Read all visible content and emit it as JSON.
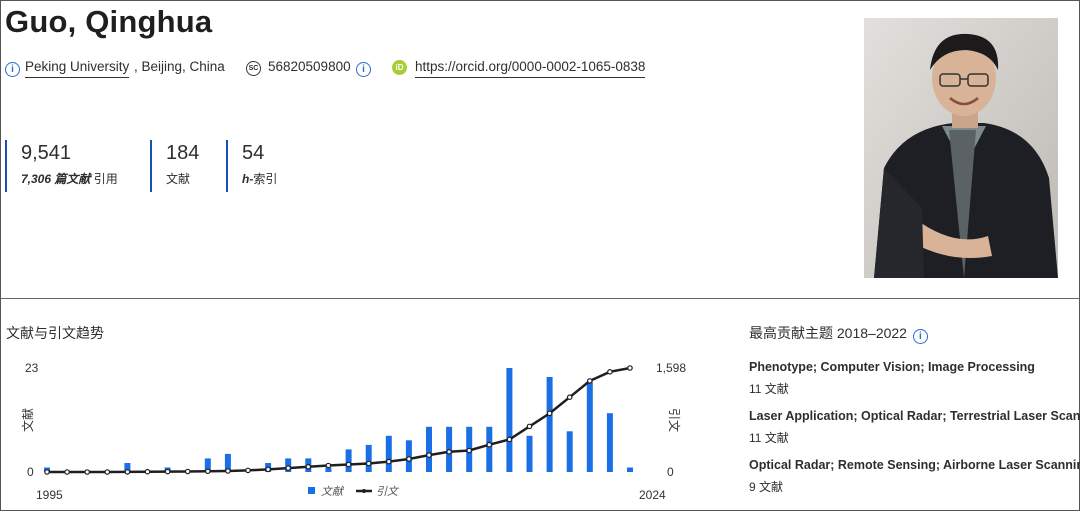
{
  "profile": {
    "name": "Guo, Qinghua",
    "affiliation_link": "Peking University",
    "affiliation_rest": ", Beijing, China",
    "scopus_id": "56820509800",
    "orcid_url": "https://orcid.org/0000-0002-1065-0838",
    "orcid_badge": "iD",
    "scopus_badge": "SC"
  },
  "metrics": [
    {
      "value": "9,541",
      "label_em": "7,306 篇文献",
      "label": "引用"
    },
    {
      "value": "184",
      "label_em": "",
      "label": "文献"
    },
    {
      "value": "54",
      "label_em": "h-",
      "label": "索引"
    }
  ],
  "trends": {
    "title": "文献与引文趋势",
    "left_axis_max": "23",
    "left_axis_min": "0",
    "right_axis_max": "1,598",
    "right_axis_min": "0",
    "left_axis_label": "文献",
    "right_axis_label": "引文",
    "x_start": "1995",
    "x_end": "2024",
    "legend_docs": "文献",
    "legend_cites": "引文"
  },
  "chart_data": {
    "type": "bar",
    "x": [
      1995,
      1996,
      1997,
      1998,
      1999,
      2000,
      2001,
      2002,
      2003,
      2004,
      2005,
      2006,
      2007,
      2008,
      2009,
      2010,
      2011,
      2012,
      2013,
      2014,
      2015,
      2016,
      2017,
      2018,
      2019,
      2020,
      2021,
      2022,
      2023,
      2024
    ],
    "series": [
      {
        "name": "文献",
        "kind": "bar",
        "axis": "left",
        "values": [
          1,
          0,
          0,
          0,
          2,
          0,
          1,
          0,
          3,
          4,
          0,
          2,
          3,
          3,
          1,
          5,
          6,
          8,
          7,
          10,
          10,
          10,
          10,
          23,
          8,
          21,
          9,
          20,
          13,
          1
        ]
      },
      {
        "name": "引文",
        "kind": "line",
        "axis": "right",
        "values": [
          0,
          0,
          0,
          0,
          2,
          4,
          6,
          8,
          10,
          15,
          25,
          40,
          60,
          80,
          100,
          115,
          130,
          160,
          200,
          260,
          310,
          330,
          420,
          500,
          700,
          900,
          1150,
          1400,
          1540,
          1598
        ]
      }
    ],
    "ylim_left": [
      0,
      23
    ],
    "ylim_right": [
      0,
      1598
    ]
  },
  "topics": {
    "title": "最高贡献主题 2018–2022",
    "items": [
      {
        "title": "Phenotype; Computer Vision; Image Processing",
        "count": "11 文献"
      },
      {
        "title": "Laser Application; Optical Radar; Terrestrial Laser Scanning",
        "count": "11 文献"
      },
      {
        "title": "Optical Radar; Remote Sensing; Airborne Laser Scanning",
        "count": "9 文献"
      }
    ]
  },
  "colors": {
    "bar": "#1a6fe6",
    "line": "#1f1f1f",
    "metric_border": "#1a4fb8",
    "link_icon": "#2b6bd6",
    "orcid": "#a6ce39"
  }
}
